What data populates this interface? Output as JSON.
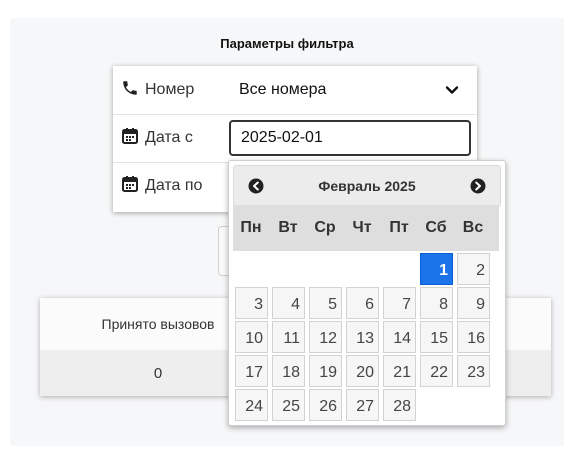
{
  "filter": {
    "title": "Параметры фильтра",
    "number_label": "Номер",
    "number_value": "Все номера",
    "date_from_label": "Дата с",
    "date_from_value": "2025-02-01",
    "date_to_label": "Дата по"
  },
  "stats": {
    "accepted_calls_header": "Принято вызовов",
    "accepted_calls_value": "0"
  },
  "datepicker": {
    "month_title": "Февраль 2025",
    "weekdays": [
      "Пн",
      "Вт",
      "Ср",
      "Чт",
      "Пт",
      "Сб",
      "Вс"
    ],
    "first_weekday_index": 5,
    "days_in_month": 28,
    "selected_day": 1,
    "selected_color": "#1a73e8"
  },
  "icons": {
    "phone": "phone-icon",
    "calendar": "calendar-icon",
    "chevron": "chevron-down-icon",
    "prev": "prev-month-icon",
    "next": "next-month-icon"
  }
}
